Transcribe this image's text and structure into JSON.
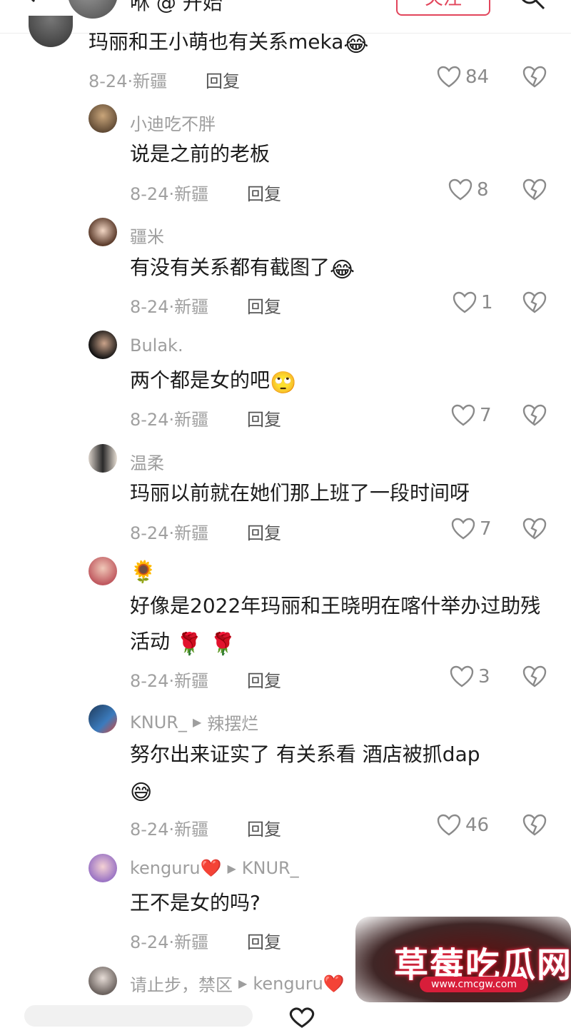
{
  "header": {
    "name": "咻 @ 开始",
    "follow_label": "关注"
  },
  "comments": [
    {
      "user": "",
      "text": "玛丽和王小萌也有关系meka",
      "emoji": "😂",
      "date": "8-24·新疆",
      "reply": "回复",
      "likes": "84"
    },
    {
      "user": "小迪吃不胖",
      "text": "说是之前的老板",
      "date": "8-24·新疆",
      "reply": "回复",
      "likes": "8"
    },
    {
      "user": "疆米",
      "text": "有没有关系都有截图了",
      "emoji": "😂",
      "date": "8-24·新疆",
      "reply": "回复",
      "likes": "1"
    },
    {
      "user": "Bulak.",
      "text": "两个都是女的吧",
      "emoji": "🙄",
      "date": "8-24·新疆",
      "reply": "回复",
      "likes": "7"
    },
    {
      "user": "温柔",
      "text": "玛丽以前就在她们那上班了一段时间呀",
      "date": "8-24·新疆",
      "reply": "回复",
      "likes": "7"
    },
    {
      "user": "🌻",
      "text": "好像是2022年玛丽和王晓明在喀什举办过助残活动",
      "emoji": "🌹 🌹",
      "date": "8-24·新疆",
      "reply": "回复",
      "likes": "3"
    },
    {
      "user": "KNUR_",
      "reply_to": "辣摆烂",
      "text": "努尔出来证实了 有关系看 酒店被抓dap",
      "emoji": "😅",
      "date": "8-24·新疆",
      "reply": "回复",
      "likes": "46"
    },
    {
      "user": "kenguru❤️",
      "reply_to": "KNUR_",
      "text": "王不是女的吗?",
      "date": "8-24·新疆",
      "reply": "回复",
      "likes": ""
    },
    {
      "user": "请止步，禁区",
      "reply_to": "kenguru❤️",
      "text": "",
      "date": "",
      "reply": "",
      "likes": ""
    }
  ],
  "watermark": {
    "title": "草莓吃瓜网",
    "url": "www.cmcgw.com"
  },
  "colors": {
    "accent": "#e2455b",
    "muted_text": "#9e9e9e",
    "text": "#1c1c1c"
  }
}
